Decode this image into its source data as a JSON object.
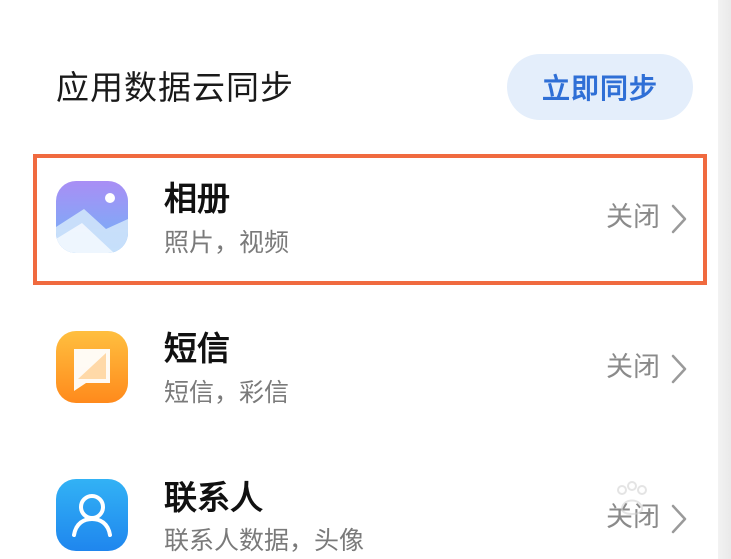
{
  "section": {
    "title": "应用数据云同步",
    "sync_button": "立即同步"
  },
  "items": [
    {
      "title": "相册",
      "subtitle": "照片，视频",
      "status": "关闭",
      "icon": "gallery-icon"
    },
    {
      "title": "短信",
      "subtitle": "短信，彩信",
      "status": "关闭",
      "icon": "messages-icon"
    },
    {
      "title": "联系人",
      "subtitle": "联系人数据，头像",
      "status": "关闭",
      "icon": "contacts-icon"
    }
  ],
  "colors": {
    "accent": "#2f6fd6",
    "highlight": "#f06a3f"
  }
}
